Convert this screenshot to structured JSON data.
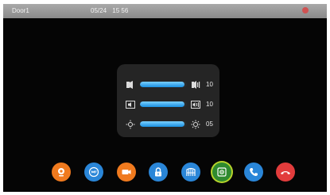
{
  "header": {
    "door_label": "Door1",
    "date": "05/24",
    "time": "15 56"
  },
  "adjust": {
    "rows": [
      {
        "left_icon": "volume-down-icon",
        "right_icon": "volume-up-icon",
        "level": 0.95,
        "value": "10"
      },
      {
        "left_icon": "speaker-low-icon",
        "right_icon": "speaker-high-icon",
        "level": 0.95,
        "value": "10"
      },
      {
        "left_icon": "brightness-low-icon",
        "right_icon": "brightness-high-icon",
        "level": 0.95,
        "value": "05"
      }
    ]
  },
  "toolbar": {
    "buttons": [
      {
        "name": "monitor-camera-button",
        "icon": "webcam-icon",
        "color": "#f07a1e"
      },
      {
        "name": "mute-button",
        "icon": "mute-icon",
        "color": "#2a86d8"
      },
      {
        "name": "record-button",
        "icon": "video-camera-icon",
        "color": "#f07a1e"
      },
      {
        "name": "unlock-button",
        "icon": "unlock-icon",
        "color": "#2a86d8"
      },
      {
        "name": "gate-button",
        "icon": "gate-icon",
        "color": "#2a86d8"
      },
      {
        "name": "settings-button",
        "icon": "settings-icon",
        "color": "#2f8a2f",
        "active": true
      },
      {
        "name": "answer-button",
        "icon": "phone-icon",
        "color": "#2a86d8"
      },
      {
        "name": "hangup-button",
        "icon": "hangup-icon",
        "color": "#e23c3c"
      }
    ]
  }
}
